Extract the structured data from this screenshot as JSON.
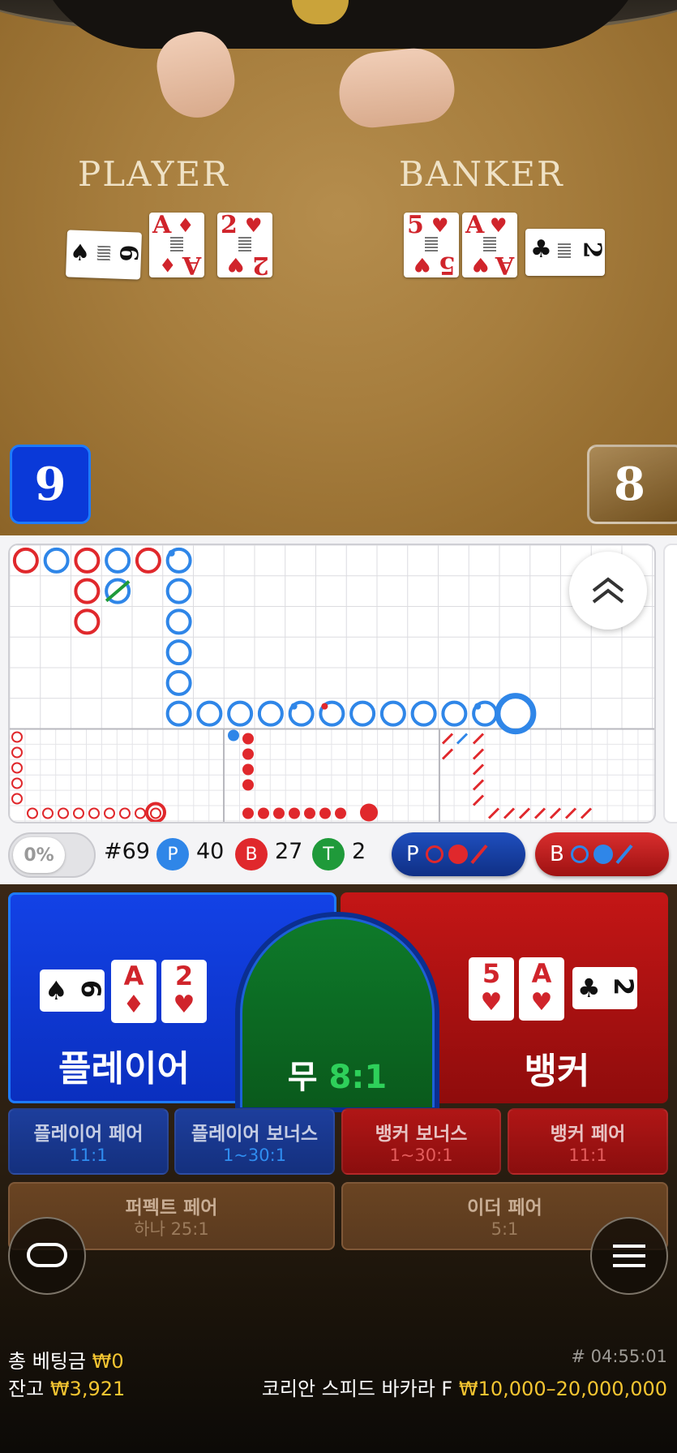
{
  "table": {
    "player_label": "PLAYER",
    "banker_label": "BANKER",
    "player_cards": [
      {
        "rank": "6",
        "suit": "♠",
        "color": "black",
        "orientation": "sideways"
      },
      {
        "rank": "A",
        "suit": "♦",
        "color": "red",
        "orientation": "upright"
      },
      {
        "rank": "2",
        "suit": "♥",
        "color": "red",
        "orientation": "upright"
      }
    ],
    "banker_cards": [
      {
        "rank": "5",
        "suit": "♥",
        "color": "red",
        "orientation": "upright"
      },
      {
        "rank": "A",
        "suit": "♥",
        "color": "red",
        "orientation": "upright"
      },
      {
        "rank": "2",
        "suit": "♣",
        "color": "black",
        "orientation": "sideways"
      }
    ],
    "player_score": "9",
    "banker_score": "8"
  },
  "roads": {
    "colors": {
      "player": "#2f86e8",
      "banker": "#e0282c",
      "tie": "#1f9a3a"
    },
    "big_road": [
      {
        "col": 0,
        "row": 0,
        "kind": "B"
      },
      {
        "col": 1,
        "row": 0,
        "kind": "P"
      },
      {
        "col": 2,
        "row": 0,
        "kind": "B"
      },
      {
        "col": 2,
        "row": 1,
        "kind": "B"
      },
      {
        "col": 2,
        "row": 2,
        "kind": "B"
      },
      {
        "col": 3,
        "row": 0,
        "kind": "P"
      },
      {
        "col": 3,
        "row": 1,
        "kind": "P",
        "tie": true
      },
      {
        "col": 4,
        "row": 0,
        "kind": "B"
      },
      {
        "col": 5,
        "row": 0,
        "kind": "P",
        "dot": "player"
      },
      {
        "col": 5,
        "row": 1,
        "kind": "P"
      },
      {
        "col": 5,
        "row": 2,
        "kind": "P"
      },
      {
        "col": 5,
        "row": 3,
        "kind": "P"
      },
      {
        "col": 5,
        "row": 4,
        "kind": "P"
      },
      {
        "col": 5,
        "row": 5,
        "kind": "P"
      },
      {
        "col": 6,
        "row": 5,
        "kind": "P"
      },
      {
        "col": 7,
        "row": 5,
        "kind": "P"
      },
      {
        "col": 8,
        "row": 5,
        "kind": "P"
      },
      {
        "col": 9,
        "row": 5,
        "kind": "P",
        "dot": "player"
      },
      {
        "col": 10,
        "row": 5,
        "kind": "P",
        "dot": "banker"
      },
      {
        "col": 11,
        "row": 5,
        "kind": "P"
      },
      {
        "col": 12,
        "row": 5,
        "kind": "P"
      },
      {
        "col": 13,
        "row": 5,
        "kind": "P"
      },
      {
        "col": 14,
        "row": 5,
        "kind": "P"
      },
      {
        "col": 15,
        "row": 5,
        "kind": "P",
        "dot": "player"
      },
      {
        "col": 16,
        "row": 5,
        "kind": "P",
        "current": true
      }
    ],
    "stats": {
      "percent": "0%",
      "round": "#69",
      "player_letter": "P",
      "player_count": "40",
      "banker_letter": "B",
      "banker_count": "27",
      "tie_letter": "T",
      "tie_count": "2"
    },
    "ask_player_label": "P",
    "ask_banker_label": "B"
  },
  "bets": {
    "player": {
      "label": "플레이어"
    },
    "tie": {
      "label": "무",
      "odds": "8:1"
    },
    "banker": {
      "label": "뱅커"
    },
    "player_pair": {
      "label": "플레이어 페어",
      "odds": "11:1"
    },
    "player_bonus": {
      "label": "플레이어 보너스",
      "odds": "1~30:1"
    },
    "banker_bonus": {
      "label": "뱅커 보너스",
      "odds": "1~30:1"
    },
    "banker_pair": {
      "label": "뱅커 페어",
      "odds": "11:1"
    },
    "perfect_pair": {
      "label": "퍼펙트 페어",
      "odds": "하나 25:1"
    },
    "either_pair": {
      "label": "이더 페어",
      "odds": "5:1"
    }
  },
  "footer": {
    "total_bet_label": "총 베팅금",
    "total_bet_value": "₩0",
    "balance_label": "잔고",
    "balance_value": "₩3,921",
    "round_id": "# 04:55:01",
    "table_name": "코리안 스피드 바카라 F",
    "limits": "₩10,000–20,000,000"
  }
}
